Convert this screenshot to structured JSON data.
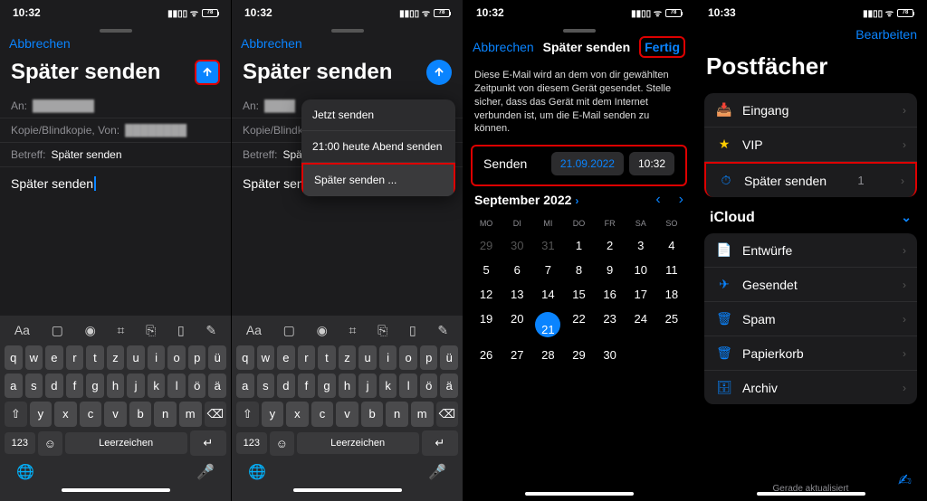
{
  "status": {
    "time1": "10:32",
    "time2": "10:32",
    "time3": "10:32",
    "time4": "10:33",
    "batt": "78"
  },
  "common": {
    "cancel": "Abbrechen",
    "done": "Fertig",
    "edit": "Bearbeiten"
  },
  "compose": {
    "title": "Später senden",
    "to_label": "An:",
    "cc_label": "Kopie/Blindkopie, Von:",
    "subject_label": "Betreff:",
    "subject_value": "Später senden",
    "body": "Später senden"
  },
  "menu": {
    "now": "Jetzt senden",
    "tonight": "21:00 heute Abend senden",
    "later": "Später senden ..."
  },
  "schedule": {
    "nav_title": "Später senden",
    "desc": "Diese E-Mail wird an dem von dir gewählten Zeitpunkt von diesem Gerät gesendet. Stelle sicher, dass das Gerät mit dem Internet verbunden ist, um die E-Mail senden zu können.",
    "send_label": "Senden",
    "date": "21.09.2022",
    "time": "10:32",
    "month": "September 2022",
    "weekdays": [
      "MO",
      "DI",
      "MI",
      "DO",
      "FR",
      "SA",
      "SO"
    ],
    "grid": [
      [
        "29",
        "30",
        "31",
        "1",
        "2",
        "3",
        "4"
      ],
      [
        "5",
        "6",
        "7",
        "8",
        "9",
        "10",
        "11"
      ],
      [
        "12",
        "13",
        "14",
        "15",
        "16",
        "17",
        "18"
      ],
      [
        "19",
        "20",
        "21",
        "22",
        "23",
        "24",
        "25"
      ],
      [
        "26",
        "27",
        "28",
        "29",
        "30",
        "",
        ""
      ]
    ],
    "today": "21"
  },
  "mailboxes": {
    "title": "Postfächer",
    "inbox": "Eingang",
    "vip": "VIP",
    "send_later": "Später senden",
    "send_later_count": "1",
    "icloud": "iCloud",
    "drafts": "Entwürfe",
    "sent": "Gesendet",
    "spam": "Spam",
    "trash": "Papierkorb",
    "archive": "Archiv",
    "footer": "Gerade aktualisiert"
  },
  "keyboard": {
    "row1": [
      "q",
      "w",
      "e",
      "r",
      "t",
      "z",
      "u",
      "i",
      "o",
      "p",
      "ü"
    ],
    "row2": [
      "a",
      "s",
      "d",
      "f",
      "g",
      "h",
      "j",
      "k",
      "l",
      "ö",
      "ä"
    ],
    "row3": [
      "⇧",
      "y",
      "x",
      "c",
      "v",
      "b",
      "n",
      "m",
      "⌫"
    ],
    "num": "123",
    "space": "Leerzeichen",
    "ret": "↵",
    "aa": "Aa"
  }
}
